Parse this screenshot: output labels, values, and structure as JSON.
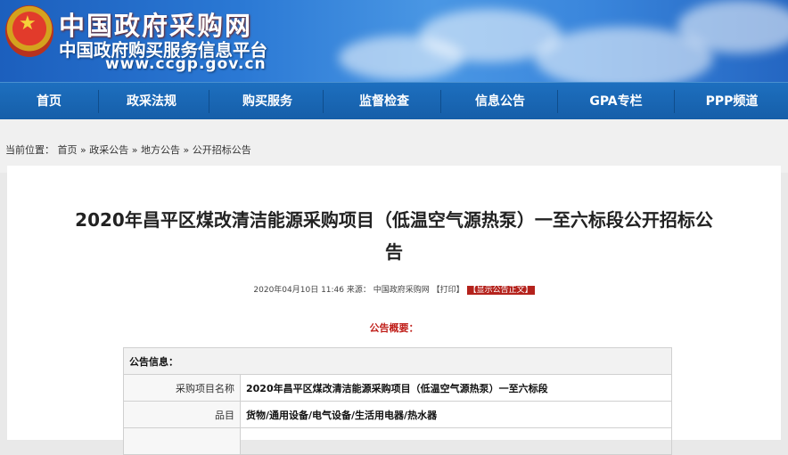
{
  "header": {
    "site_title": "中国政府采购网",
    "site_subtitle": "中国政府购买服务信息平台",
    "site_url": "www.ccgp.gov.cn"
  },
  "nav": {
    "items": [
      "首页",
      "政采法规",
      "购买服务",
      "监督检查",
      "信息公告",
      "GPA专栏",
      "PPP频道"
    ]
  },
  "breadcrumb": {
    "prefix": "当前位置：",
    "items": [
      "首页",
      "政采公告",
      "地方公告",
      "公开招标公告"
    ],
    "separator": "»"
  },
  "article": {
    "title_line1": "2020年昌平区煤改清洁能源采购项目（低温空气源热泵）一至六标段公开招标公",
    "title_line2": "告",
    "datetime": "2020年04月10日 11:46",
    "source_label": "来源：",
    "source": "中国政府采购网",
    "print": "【打印】",
    "show_text": "【显示公告正文】",
    "summary_heading": "公告概要："
  },
  "info_table": {
    "header": "公告信息：",
    "rows": [
      {
        "key": "采购项目名称",
        "value": "2020年昌平区煤改清洁能源采购项目（低温空气源热泵）一至六标段"
      },
      {
        "key": "品目",
        "value": "货物/通用设备/电气设备/生活用电器/热水器"
      }
    ]
  },
  "colors": {
    "nav_bg": "#1a66b4",
    "accent_red": "#c0201b",
    "banner_blue": "#2a78d4"
  }
}
